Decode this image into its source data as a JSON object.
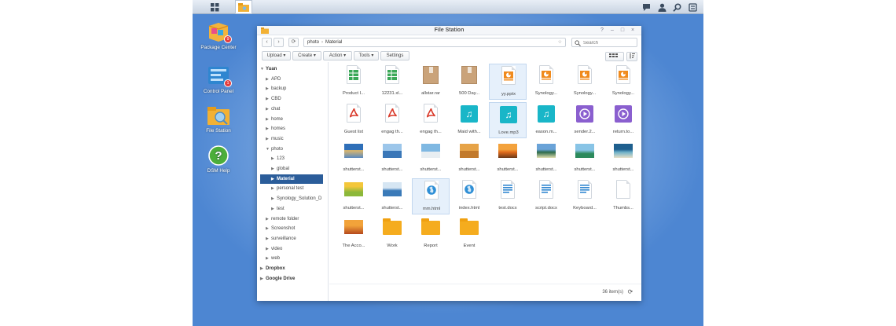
{
  "desktop": {
    "icons": [
      {
        "label": "Package Center",
        "badge": "9"
      },
      {
        "label": "Control Panel",
        "badge": "1"
      },
      {
        "label": "File Station",
        "badge": ""
      },
      {
        "label": "DSM Help",
        "badge": ""
      }
    ]
  },
  "window": {
    "title": "File Station",
    "controls": {
      "help": "?",
      "minimize": "–",
      "maximize": "□",
      "close": "×"
    }
  },
  "nav": {
    "back": "‹",
    "forward": "›",
    "refresh": "⟳",
    "path": [
      "photo",
      "Material"
    ],
    "search_placeholder": "Search"
  },
  "toolbar": {
    "upload": "Upload ▾",
    "create": "Create ▾",
    "action": "Action ▾",
    "tools": "Tools ▾",
    "settings": "Settings"
  },
  "tree": {
    "root": "Yuan",
    "items": [
      "APD",
      "backup",
      "CBD",
      "chat",
      "home",
      "homes",
      "music",
      "photo",
      "123",
      "global",
      "Material",
      "personal test",
      "Synology_Solution_D",
      "test",
      "remote folder",
      "Screenshot",
      "surveillance",
      "video",
      "web"
    ],
    "dropbox": "Dropbox",
    "google_drive": "Google Drive"
  },
  "files": [
    {
      "name": "Product I...",
      "icon": "spreadsheet-icon"
    },
    {
      "name": "12231.xl...",
      "icon": "spreadsheet-icon"
    },
    {
      "name": "allstar.rar",
      "icon": "archive-icon"
    },
    {
      "name": "500 Day...",
      "icon": "archive-icon"
    },
    {
      "name": "yy.pptx",
      "icon": "presentation-icon"
    },
    {
      "name": "Synology...",
      "icon": "presentation-icon"
    },
    {
      "name": "Synology...",
      "icon": "presentation-icon"
    },
    {
      "name": "Synology...",
      "icon": "presentation-icon"
    },
    {
      "name": "Guest list",
      "icon": "pdf-icon"
    },
    {
      "name": "engag th...",
      "icon": "pdf-icon"
    },
    {
      "name": "engag th...",
      "icon": "pdf-icon"
    },
    {
      "name": "Maid with...",
      "icon": "music-icon"
    },
    {
      "name": "Love.mp3",
      "icon": "music-icon"
    },
    {
      "name": "eason.m...",
      "icon": "music-icon"
    },
    {
      "name": "sender.2...",
      "icon": "video-icon"
    },
    {
      "name": "return.to...",
      "icon": "video-icon"
    },
    {
      "name": "shutterst...",
      "icon": "image-thumbnail"
    },
    {
      "name": "shutterst...",
      "icon": "image-thumbnail"
    },
    {
      "name": "shutterst...",
      "icon": "image-thumbnail"
    },
    {
      "name": "shutterst...",
      "icon": "image-thumbnail"
    },
    {
      "name": "shutterst...",
      "icon": "image-thumbnail"
    },
    {
      "name": "shutterst...",
      "icon": "image-thumbnail"
    },
    {
      "name": "shutterst...",
      "icon": "image-thumbnail"
    },
    {
      "name": "shutterst...",
      "icon": "image-thumbnail"
    },
    {
      "name": "shutterst...",
      "icon": "image-thumbnail"
    },
    {
      "name": "shutterst...",
      "icon": "image-thumbnail"
    },
    {
      "name": "mm.html",
      "icon": "html-icon"
    },
    {
      "name": "index.html",
      "icon": "html-icon"
    },
    {
      "name": "test.docx",
      "icon": "document-icon"
    },
    {
      "name": "script.docx",
      "icon": "document-icon"
    },
    {
      "name": "Keyboard...",
      "icon": "document-icon"
    },
    {
      "name": "Thumbs...",
      "icon": "blank-file-icon"
    },
    {
      "name": "The Acco...",
      "icon": "image-thumbnail"
    },
    {
      "name": "Work",
      "icon": "folder-icon"
    },
    {
      "name": "Report",
      "icon": "folder-icon"
    },
    {
      "name": "Event",
      "icon": "folder-icon"
    }
  ],
  "status": {
    "count": "36 item(s)"
  },
  "colors": {
    "spreadsheet": "#3aa757",
    "pdf": "#d93a2b",
    "presentation": "#f08a1c",
    "music": "#19b6c8",
    "video": "#8a5fcf",
    "html": "#2f8fd6",
    "document": "#2f86d0",
    "folder": "#f5ac1e",
    "selection": "#2b5d9a"
  }
}
